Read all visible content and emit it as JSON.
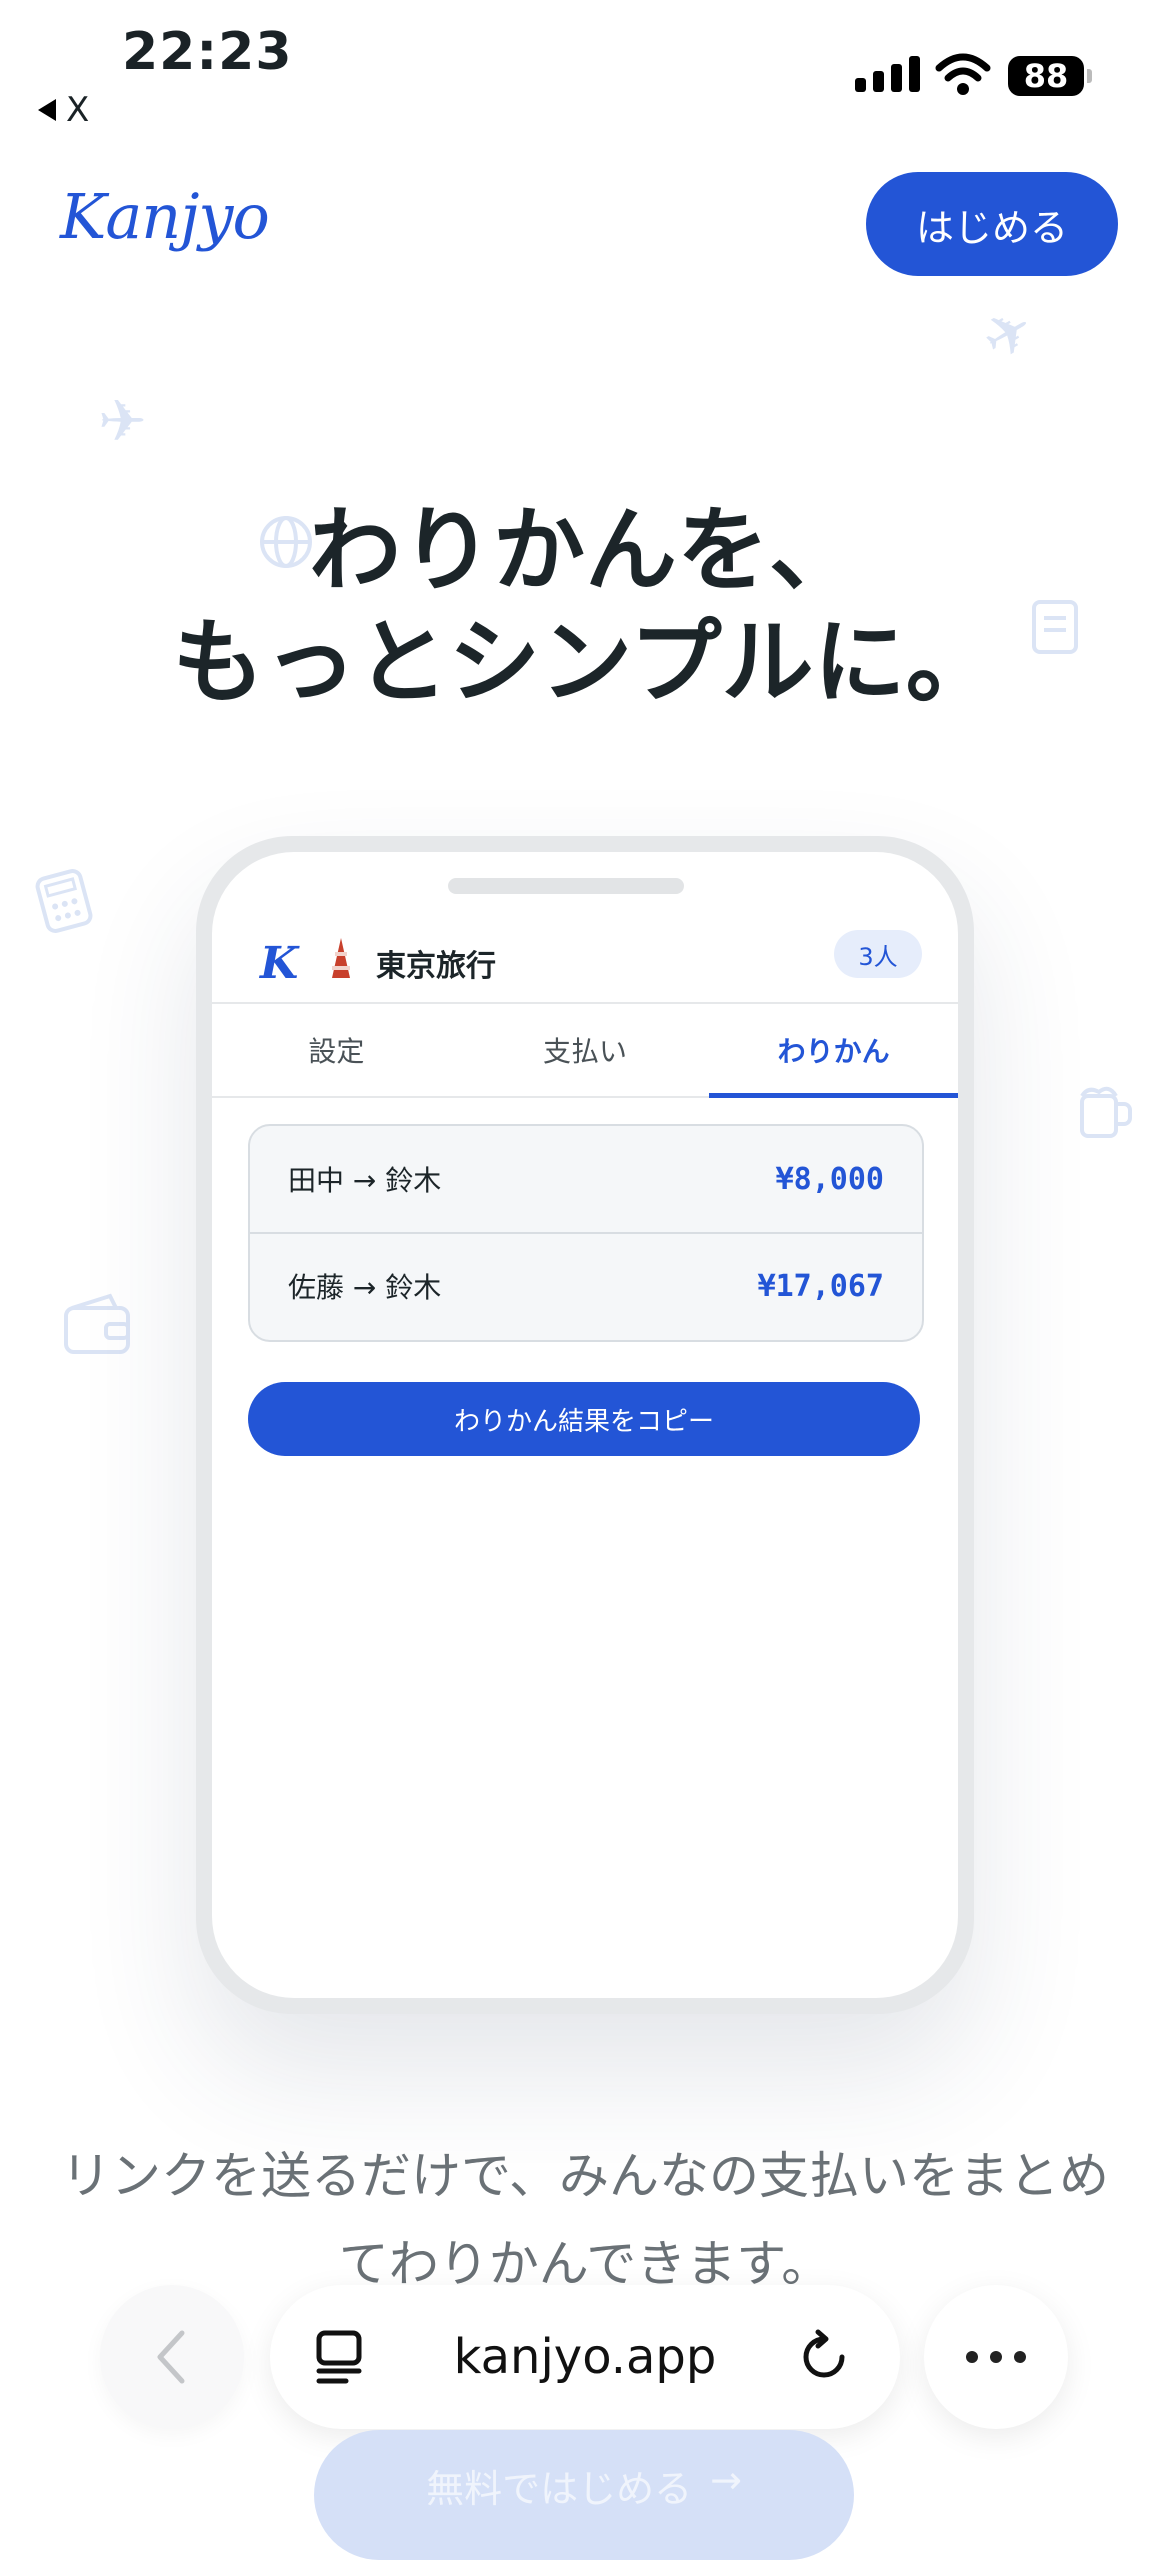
{
  "status_bar": {
    "time": "22:23",
    "back_label": "X",
    "battery": "88"
  },
  "header": {
    "logo": "Kanjyo",
    "start_button": "はじめる"
  },
  "hero": {
    "title_line1": "わりかんを、",
    "title_line2": "もっとシンプルに。"
  },
  "app_preview": {
    "trip_title": "東京旅行",
    "member_count": "3人",
    "tabs": [
      {
        "label": "設定"
      },
      {
        "label": "支払い"
      },
      {
        "label": "わりかん"
      }
    ],
    "active_tab": "わりかん",
    "settlements": [
      {
        "pair": "田中 → 鈴木",
        "amount": "¥8,000"
      },
      {
        "pair": "佐藤 → 鈴木",
        "amount": "¥17,067"
      }
    ],
    "copy_button": "わりかん結果をコピー"
  },
  "description": "リンクを送るだけで、みんなの支払いをまとめてわりかんできます。",
  "browser": {
    "url": "kanjyo.app"
  },
  "cta": {
    "free_start": "無料ではじめる",
    "arrow": "→"
  },
  "colors": {
    "accent": "#2355d6",
    "text": "#1c2529",
    "muted": "#6a7176"
  }
}
